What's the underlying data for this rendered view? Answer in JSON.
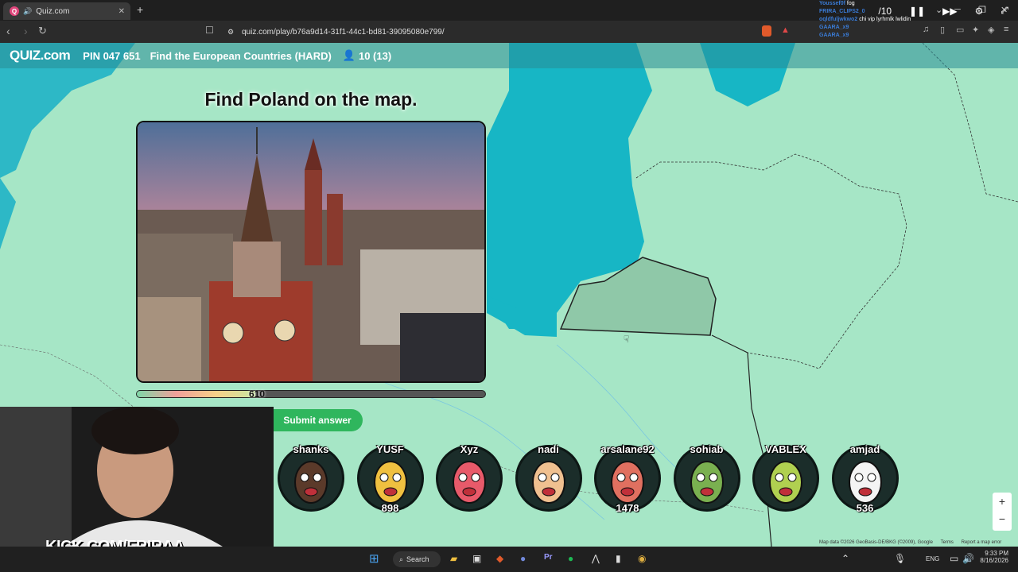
{
  "browser": {
    "tab_title": "Quiz.com",
    "url": "quiz.com/play/b76a9d14-31f1-44c1-bd81-39095080e799/"
  },
  "quiz": {
    "logo": "QUIZ.com",
    "pin": "PIN 047 651",
    "title": "Find the European Countries (HARD)",
    "players": "10 (13)",
    "question": "Find Poland on the map.",
    "timer_value": "610",
    "timer_fraction": 0.34,
    "submit_label": "Submit answer",
    "round": "/10"
  },
  "players": [
    {
      "name": "shanks",
      "score": ""
    },
    {
      "name": "YUSF",
      "score": "898"
    },
    {
      "name": "Xyz",
      "score": ""
    },
    {
      "name": "nadi",
      "score": ""
    },
    {
      "name": "arsalane92",
      "score": "1478"
    },
    {
      "name": "sohiab",
      "score": ""
    },
    {
      "name": "VABLEX",
      "score": ""
    },
    {
      "name": "amjad",
      "score": "536"
    }
  ],
  "stream": {
    "kick": "KICK.COM/FRIRAA",
    "chat": [
      {
        "user": "Youssef0f",
        "msg": "fog"
      },
      {
        "user": "FRIRA_CLIPS2_0",
        "msg": ""
      },
      {
        "user": "oqldfuljwkwo2",
        "msg": "chi vip lyrhmlk lwlidin"
      },
      {
        "user": "GAARA_x9",
        "msg": ""
      },
      {
        "user": "GAARA_x9",
        "msg": ""
      }
    ]
  },
  "map_attribution": "Map data ©2026 GeoBasis-DE/BKG (©2009), Google",
  "map_links": [
    "Terms",
    "Report a map error"
  ],
  "taskbar": {
    "search": "Search",
    "lang": "ENG",
    "time": "9:33 PM",
    "date": "8/16/2026"
  }
}
